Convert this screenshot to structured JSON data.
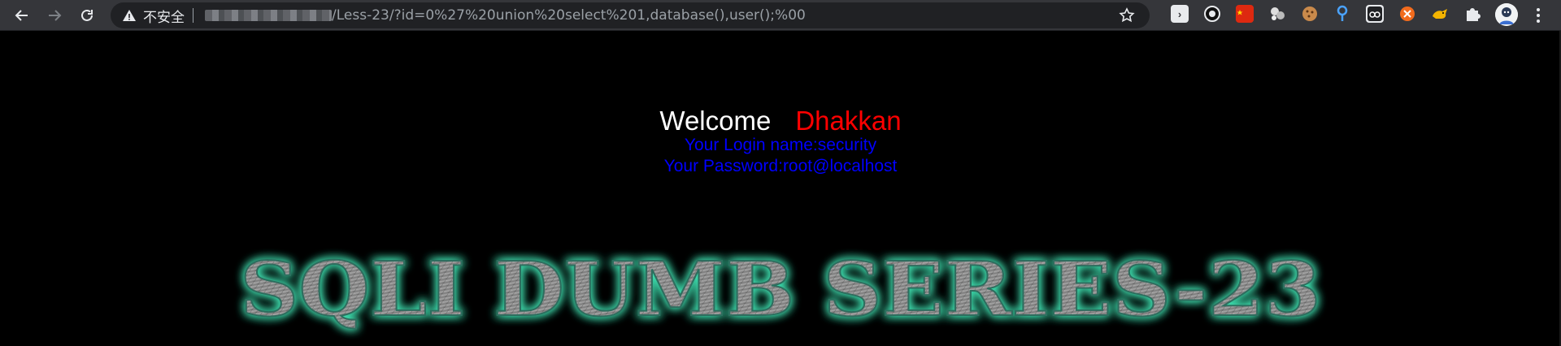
{
  "browser": {
    "security_label": "不安全",
    "url_path": "/Less-23/?id=0%27%20union%20select%201,database(),user();%00",
    "extensions": [
      "terminal-ext-icon",
      "circle-ext-icon",
      "china-flag-ext-icon",
      "bubbles-ext-icon",
      "cookie-ext-icon",
      "pin-ext-icon",
      "glasses-ext-icon",
      "orange-ext-icon",
      "tiger-ext-icon",
      "puzzle-icon"
    ]
  },
  "page": {
    "welcome": "Welcome",
    "name": "Dhakkan",
    "login_line": "Your Login name:security",
    "password_line": "Your Password:root@localhost",
    "banner": "SQLI DUMB SERIES-23"
  },
  "colors": {
    "welcome": "#ffffff",
    "name": "#ff0000",
    "info": "#0000ff",
    "banner_glow": "#3fe0b0"
  }
}
